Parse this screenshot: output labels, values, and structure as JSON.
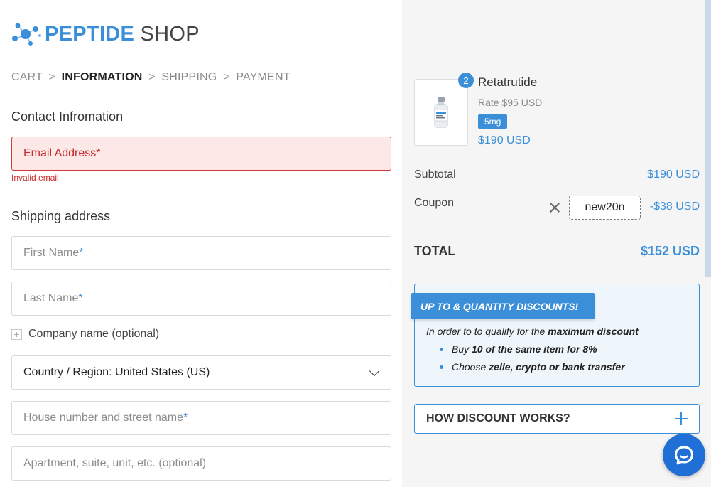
{
  "brand": {
    "bold": "PEPTIDE",
    "light": " SHOP"
  },
  "breadcrumb": {
    "cart": "CART",
    "information": "INFORMATION",
    "shipping": "SHIPPING",
    "payment": "PAYMENT",
    "sep": ">"
  },
  "contact": {
    "title": "Contact Infromation",
    "email_placeholder": "Email Address",
    "email_error": "Invalid email"
  },
  "shipping": {
    "title": "Shipping address",
    "first_name": "First Name",
    "last_name": "Last Name",
    "company": "Company name (optional)",
    "country": "Country / Region: United States (US)",
    "street": "House number and street name",
    "apartment": "Apartment, suite, unit, etc. (optional)",
    "required_mark": "*"
  },
  "summary": {
    "product": {
      "name": "Retatrutide",
      "rate": "Rate $95 USD",
      "tag": "5mg",
      "price": "$190 USD",
      "quantity": "2"
    },
    "subtotal_label": "Subtotal",
    "subtotal_value": "$190 USD",
    "coupon_label": "Coupon",
    "coupon_code": "new20n",
    "coupon_value": "-$38 USD",
    "total_label": "TOTAL",
    "total_value": "$152 USD"
  },
  "promo": {
    "heading": "UP TO & QUANTITY DISCOUNTS!",
    "intro_plain": "In order to to qualify for the ",
    "intro_bold": "maximum discount",
    "items": [
      {
        "plain": "Buy ",
        "bold": "10 of the same item for 8%"
      },
      {
        "plain": "Choose ",
        "bold": "zelle, crypto or bank transfer"
      }
    ]
  },
  "how": {
    "label": "HOW DISCOUNT WORKS?"
  },
  "colors": {
    "accent": "#3b8fd8",
    "error": "#c62828",
    "chat": "#1f6fd6"
  },
  "icons": {
    "logo": "molecule-icon",
    "chat": "chat-bubble-icon",
    "expand": "plus-icon",
    "remove": "close-icon",
    "dropdown": "chevron-down-icon"
  }
}
